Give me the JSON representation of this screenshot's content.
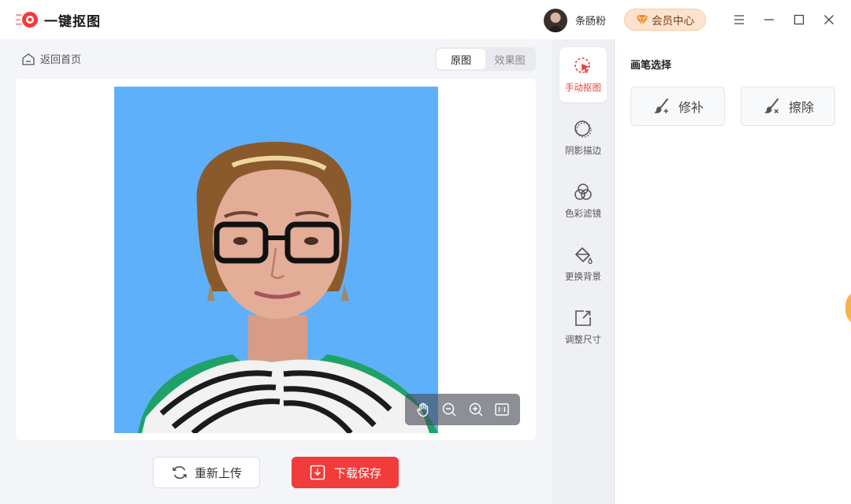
{
  "app": {
    "title": "一键抠图"
  },
  "header": {
    "username": "条肠粉",
    "vip_label": "会员中心"
  },
  "nav": {
    "back_label": "返回首页"
  },
  "view_tabs": [
    {
      "label": "原图",
      "active": true
    },
    {
      "label": "效果图",
      "active": false
    }
  ],
  "actions": {
    "reupload_label": "重新上传",
    "save_label": "下载保存"
  },
  "tools": [
    {
      "label": "手动抠图",
      "icon": "cursor-select-icon",
      "active": true
    },
    {
      "label": "阴影描边",
      "icon": "shadow-outline-icon",
      "active": false
    },
    {
      "label": "色彩滤镜",
      "icon": "color-filter-icon",
      "active": false
    },
    {
      "label": "更换背景",
      "icon": "paint-bucket-icon",
      "active": false
    },
    {
      "label": "调整尺寸",
      "icon": "resize-icon",
      "active": false
    }
  ],
  "panel": {
    "title": "画笔选择",
    "brushes": [
      {
        "label": "修补",
        "icon": "brush-repair-icon"
      },
      {
        "label": "擦除",
        "icon": "brush-erase-icon"
      }
    ]
  },
  "zoom_controls": [
    "hand-icon",
    "zoom-out-icon",
    "zoom-in-icon",
    "actual-size-icon"
  ],
  "colors": {
    "accent": "#f23b3b",
    "photo_background": "#5fb0fb",
    "vip_background": "#fde3cd"
  }
}
